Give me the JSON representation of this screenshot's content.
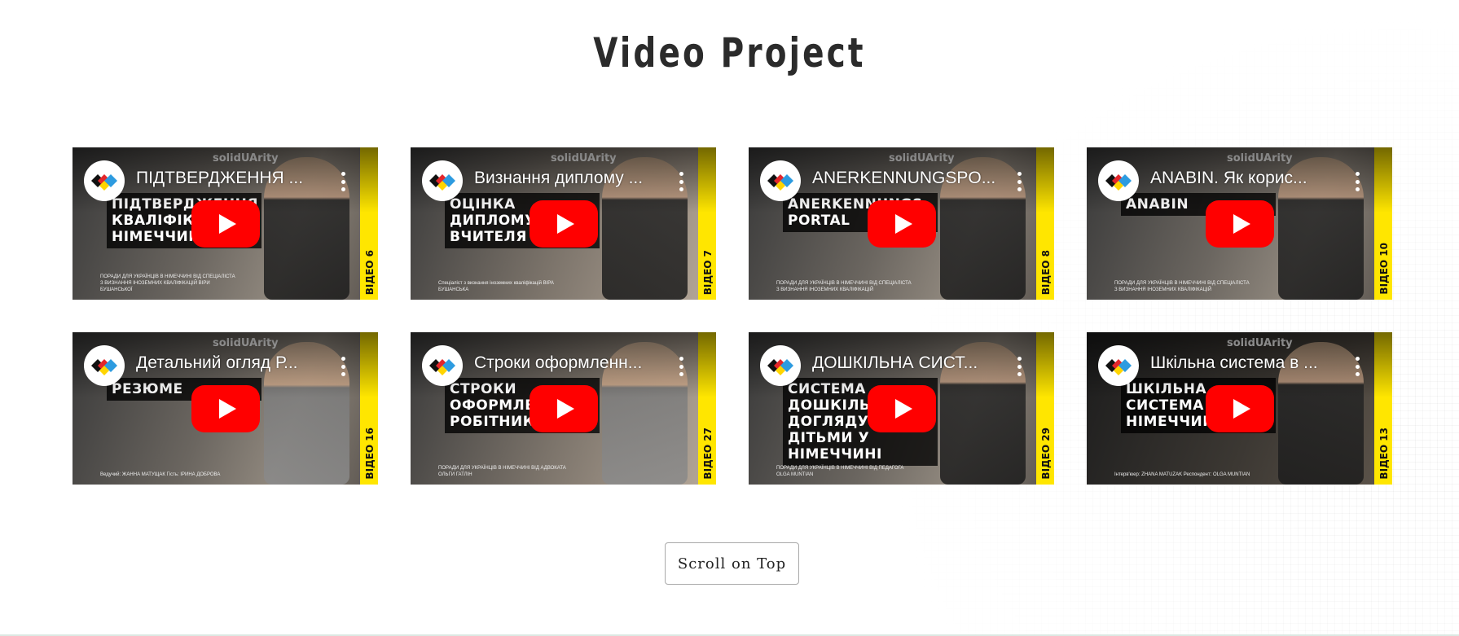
{
  "page": {
    "title": "Video Project",
    "scroll_button": "Scroll on Top"
  },
  "colors": {
    "youtube_red": "#ff0000",
    "strip_yellow": "#ffe600",
    "button_border": "#a9a9a9"
  },
  "videos": [
    {
      "title": "ПІДТВЕРДЖЕННЯ ...",
      "headline": "Підтвердження кваліфікації у Німеччині",
      "episode": "ВІДЕО 6",
      "logo": "solidUArity",
      "footnote": "ПОРАДИ ДЛЯ УКРАЇНЦІВ В НІМЕЧЧИНІ ВІД СПЕЦІАЛІСТА З ВИЗНАННЯ ІНОЗЕМНИХ КВАЛІФІКАЦІЙ ВІРИ БУШАНСЬКОЇ"
    },
    {
      "title": "Визнання диплому ...",
      "headline": "Оцінка диплому вчителя",
      "episode": "ВІДЕО 7",
      "logo": "solidUArity",
      "footnote": "Спеціаліст з визнання іноземних кваліфікацій ВІРА БУШАНСЬКА"
    },
    {
      "title": "ANERKENNUNGSPO...",
      "headline": "Anerkennungs Portal",
      "episode": "ВІДЕО 8",
      "logo": "solidUArity",
      "footnote": "ПОРАДИ ДЛЯ УКРАЇНЦІВ В НІМЕЧЧИНІ ВІД СПЕЦІАЛІСТА З ВИЗНАННЯ ІНОЗЕМНИХ КВАЛІФІКАЦІЙ"
    },
    {
      "title": "ANABIN. Як корис...",
      "headline": "ANABIN",
      "episode": "ВІДЕО 10",
      "logo": "solidUArity",
      "footnote": "ПОРАДИ ДЛЯ УКРАЇНЦІВ В НІМЕЧЧИНІ ВІД СПЕЦІАЛІСТА З ВИЗНАННЯ ІНОЗЕМНИХ КВАЛІФІКАЦІЙ"
    },
    {
      "title": "Детальний огляд Р...",
      "headline": "Резюме",
      "episode": "ВІДЕО 16",
      "logo": "solidUArity",
      "footnote": "Ведучий: ЖАННА МАТУЩАК Гість: ІРИНА ДОБРОВА"
    },
    {
      "title": "Строки оформленн...",
      "headline": "Строки оформлення робітника",
      "episode": "ВІДЕО 27",
      "logo": "",
      "footnote": "ПОРАДИ ДЛЯ УКРАЇНЦІВ В НІМЕЧЧИНІ ВІД АДВОКАТА ОЛЬГИ ГАТЛІН"
    },
    {
      "title": "ДОШКІЛЬНА СИСТ...",
      "headline": "Система дошкільного догляду за дітьми у Німеччині",
      "episode": "ВІДЕО 29",
      "logo": "",
      "footnote": "ПОРАДИ ДЛЯ УКРАЇНЦІВ В НІМЕЧЧИНІ ВІД ПЕДАГОГА OLGA MUNTIAN"
    },
    {
      "title": "Шкільна система в ...",
      "headline": "Шкільна система в Німеччині",
      "episode": "ВІДЕО 13",
      "logo": "solidUArity",
      "footnote": "Інтерв'юер: ZHANA MATUZAK Респондент: OLGA MUNTIAN"
    }
  ]
}
